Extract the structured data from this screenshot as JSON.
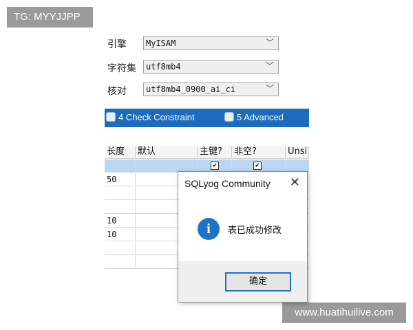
{
  "tg_label": "TG: MYYJJPP",
  "watermark": "www.huatihuilive.com",
  "form": {
    "engine_label": "引擎",
    "engine_value": "MyISAM",
    "charset_label": "字符集",
    "charset_value": "utf8mb4",
    "collation_label": "核对",
    "collation_value": "utf8mb4_0900_ai_ci",
    "chevron": "﹀"
  },
  "tabs": [
    {
      "label": "4 Check Constraint",
      "icon": "calendar-icon"
    },
    {
      "label": "5 Advanced",
      "icon": "settings-icon"
    }
  ],
  "columns": [
    "长度",
    "默认",
    "主键?",
    "非空?",
    "Unsi"
  ],
  "rows": [
    {
      "length": "",
      "pk": true,
      "nn": true
    },
    {
      "length": "50"
    },
    {
      "length": ""
    },
    {
      "length": ""
    },
    {
      "length": "10"
    },
    {
      "length": "10"
    },
    {
      "length": ""
    },
    {
      "length": ""
    }
  ],
  "checkmark": "✔",
  "dialog": {
    "title": "SQLyog Community",
    "close": "✕",
    "icon": "info-icon",
    "icon_glyph": "i",
    "message": "表已成功修改",
    "ok": "确定"
  },
  "colors": {
    "accent": "#1e73c8",
    "tab_bar": "#1d6bbd",
    "selected_row": "#bcd7f4"
  }
}
